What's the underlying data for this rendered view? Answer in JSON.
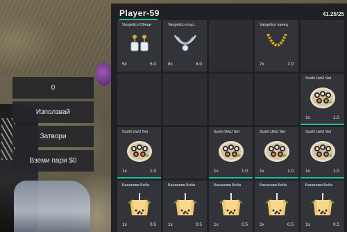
{
  "player": {
    "name": "Player-59",
    "weight": "41.25/25"
  },
  "menu": {
    "amount_value": "0",
    "use_label": "Използвай",
    "close_label": "Затвори",
    "take_money_label": "Вземи пари $0"
  },
  "inventory": {
    "slots": [
      {
        "label": "Vangelico Обеци",
        "count": "5x",
        "weight": "5.0",
        "icon": "earrings-icon",
        "bar": false
      },
      {
        "label": "Vangelico огър..",
        "count": "8x",
        "weight": "8.0",
        "icon": "necklace-icon",
        "bar": false
      },
      {
        "label": "",
        "count": "",
        "weight": "",
        "icon": "",
        "bar": false
      },
      {
        "label": "Vangelico ланец",
        "count": "7x",
        "weight": "7.0",
        "icon": "chain-icon",
        "bar": false
      },
      {
        "label": "",
        "count": "",
        "weight": "",
        "icon": "",
        "bar": false
      },
      {
        "label": "",
        "count": "",
        "weight": "",
        "icon": "",
        "bar": false
      },
      {
        "label": "",
        "count": "",
        "weight": "",
        "icon": "",
        "bar": false
      },
      {
        "label": "",
        "count": "",
        "weight": "",
        "icon": "",
        "bar": false
      },
      {
        "label": "",
        "count": "",
        "weight": "",
        "icon": "",
        "bar": false
      },
      {
        "label": "Sushi UwU Set",
        "count": "1x",
        "weight": "1.0",
        "icon": "sushi-icon",
        "bar": true
      },
      {
        "label": "Sushi UwU Set",
        "count": "1x",
        "weight": "1.0",
        "icon": "sushi-icon",
        "bar": true
      },
      {
        "label": "",
        "count": "",
        "weight": "",
        "icon": "",
        "bar": false
      },
      {
        "label": "Sushi UwU Set",
        "count": "1x",
        "weight": "1.0",
        "icon": "sushi-icon",
        "bar": true
      },
      {
        "label": "Sushi UwU Set",
        "count": "1x",
        "weight": "1.0",
        "icon": "sushi-icon",
        "bar": true
      },
      {
        "label": "Sushi UwU Set",
        "count": "1x",
        "weight": "1.0",
        "icon": "sushi-icon",
        "bar": true
      },
      {
        "label": "Бананова Боба",
        "count": "1x",
        "weight": "0.5",
        "icon": "boba-icon",
        "bar": false
      },
      {
        "label": "Бананова Боба",
        "count": "1x",
        "weight": "0.5",
        "icon": "boba-icon",
        "bar": false
      },
      {
        "label": "Бананова Боба",
        "count": "1x",
        "weight": "0.5",
        "icon": "boba-icon",
        "bar": false
      },
      {
        "label": "Бананова Боба",
        "count": "1x",
        "weight": "0.5",
        "icon": "boba-icon",
        "bar": false
      },
      {
        "label": "Бананова Боба",
        "count": "1x",
        "weight": "0.5",
        "icon": "boba-icon",
        "bar": false
      }
    ]
  },
  "colors": {
    "accent": "#19c2a0",
    "panel_bg": "#1c1d22",
    "slot_bg": "#2d2e34"
  }
}
